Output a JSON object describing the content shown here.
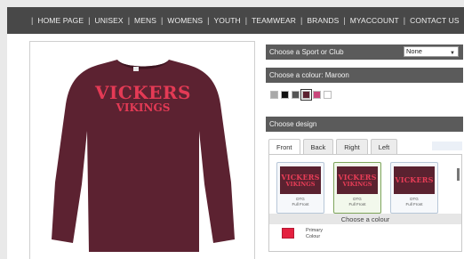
{
  "nav": {
    "items": [
      "HOME PAGE",
      "UNISEX",
      "MENS",
      "WOMENS",
      "YOUTH",
      "TEAMWEAR",
      "BRANDS",
      "MYACCOUNT",
      "CONTACT US"
    ],
    "separator": "|"
  },
  "product": {
    "print_line1": "VICKERS",
    "print_line2": "VIKINGS",
    "garment_color": "#5c2231",
    "print_color": "#e43a55"
  },
  "sport": {
    "label": "Choose a Sport or Club",
    "selected": "None",
    "icon": "chevron-down-icon"
  },
  "colour": {
    "label": "Choose a colour: Maroon",
    "swatches": [
      {
        "name": "grey",
        "hex": "#a9a9a9"
      },
      {
        "name": "black",
        "hex": "#111111"
      },
      {
        "name": "charcoal",
        "hex": "#555555"
      },
      {
        "name": "maroon",
        "hex": "#5c2231",
        "selected": true
      },
      {
        "name": "pink",
        "hex": "#c9477c"
      },
      {
        "name": "white",
        "hex": "#ffffff"
      }
    ]
  },
  "design": {
    "label": "Choose design",
    "tabs": [
      "Front",
      "Back",
      "Right",
      "Left"
    ],
    "active_tab": "Front",
    "cards": [
      {
        "line1": "VICKERS",
        "line2": "VIKINGS",
        "caption1": "DTG",
        "caption2": "Full Front"
      },
      {
        "line1": "VICKERS",
        "line2": "VIKINGS",
        "caption1": "DTG",
        "caption2": "Full Front",
        "active": true
      },
      {
        "line1": "VICKERS",
        "line2": "",
        "caption1": "DTG",
        "caption2": "Full Front"
      }
    ],
    "choose_colour_label": "Choose a colour",
    "primary_label_1": "Primary",
    "primary_label_2": "Colour",
    "primary_color": "#e4203f"
  }
}
